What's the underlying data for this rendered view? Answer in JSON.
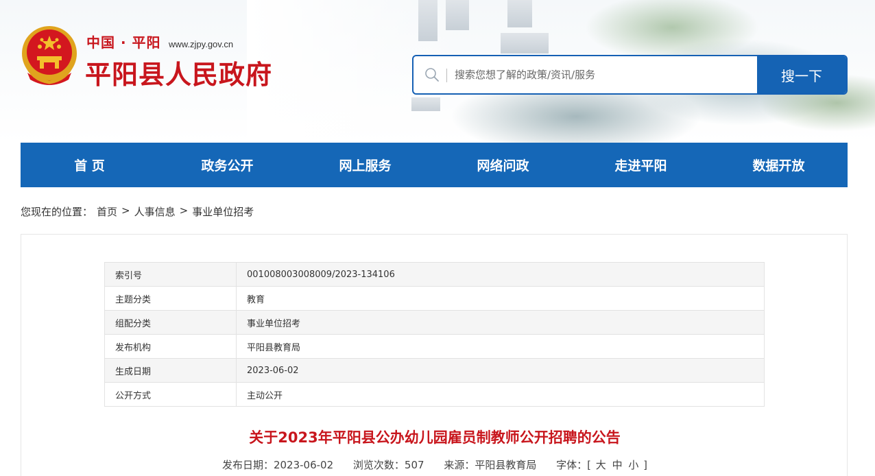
{
  "header": {
    "brand_small": "中国 · 平阳",
    "brand_url": "www.zjpy.gov.cn",
    "brand_title": "平阳县人民政府"
  },
  "search": {
    "placeholder": "搜索您想了解的政策/资讯/服务",
    "button_label": "搜一下"
  },
  "nav": {
    "items": [
      "首 页",
      "政务公开",
      "网上服务",
      "网络问政",
      "走进平阳",
      "数据开放"
    ]
  },
  "breadcrumb": {
    "prefix": "您现在的位置：",
    "items": [
      "首页",
      "人事信息",
      "事业单位招考"
    ],
    "separator": ">"
  },
  "meta_table": [
    {
      "key": "索引号",
      "value": "001008003008009/2023-134106"
    },
    {
      "key": "主题分类",
      "value": "教育"
    },
    {
      "key": "组配分类",
      "value": "事业单位招考"
    },
    {
      "key": "发布机构",
      "value": "平阳县教育局"
    },
    {
      "key": "生成日期",
      "value": "2023-06-02"
    },
    {
      "key": "公开方式",
      "value": "主动公开"
    }
  ],
  "article": {
    "title": "关于2023年平阳县公办幼儿园雇员制教师公开招聘的公告",
    "date_label": "发布日期：2023-06-02",
    "views_label": "浏览次数：507",
    "source_label": "来源：平阳县教育局",
    "font_label": "字体：[",
    "font_large": "大",
    "font_medium": "中",
    "font_small": "小",
    "font_close": "]"
  },
  "colors": {
    "brand_red": "#c8161d",
    "nav_blue": "#1567b7"
  }
}
